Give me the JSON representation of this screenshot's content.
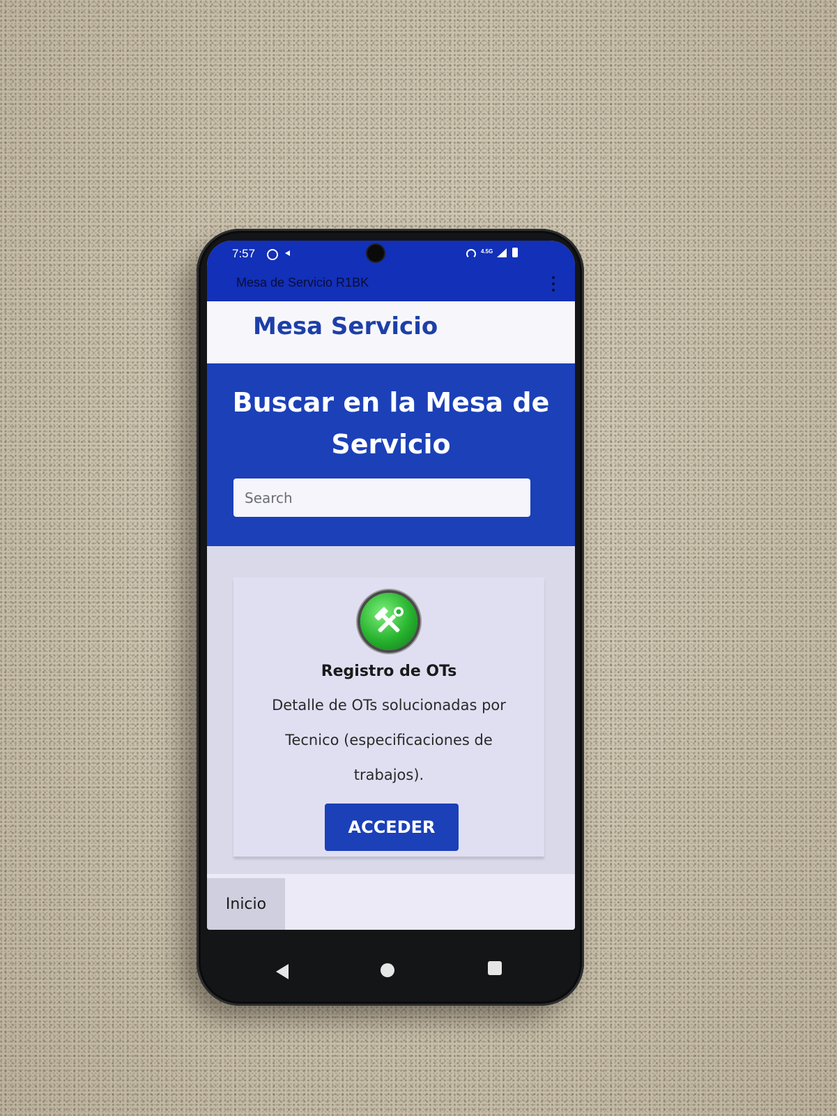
{
  "status_bar": {
    "time": "7:57",
    "network": "4.5G",
    "icons": [
      "whatsapp-icon",
      "navigation-icon",
      "hotspot-icon",
      "signal-icon",
      "battery-icon"
    ]
  },
  "app_bar": {
    "title": "Mesa de Servicio R1BK",
    "menu_icon": "overflow-menu-icon"
  },
  "header": {
    "brand": "Mesa Servicio"
  },
  "hero": {
    "title": "Buscar en la Mesa de Servicio",
    "search_placeholder": "Search"
  },
  "card": {
    "icon": "tools-icon",
    "title": "Registro de OTs",
    "description": "Detalle de OTs solucionadas por Tecnico (especificaciones de trabajos).",
    "button_label": "ACCEDER"
  },
  "bottom_nav": {
    "items": [
      {
        "label": "Inicio"
      }
    ]
  },
  "system_nav": {
    "icons": [
      "back-icon",
      "home-icon",
      "recents-icon"
    ]
  },
  "colors": {
    "app_bar": "#1230b8",
    "brand_text": "#1d3fa8",
    "hero_background": "#1b40b8",
    "button_background": "#1b40b8",
    "icon_green": "#27b22e"
  }
}
